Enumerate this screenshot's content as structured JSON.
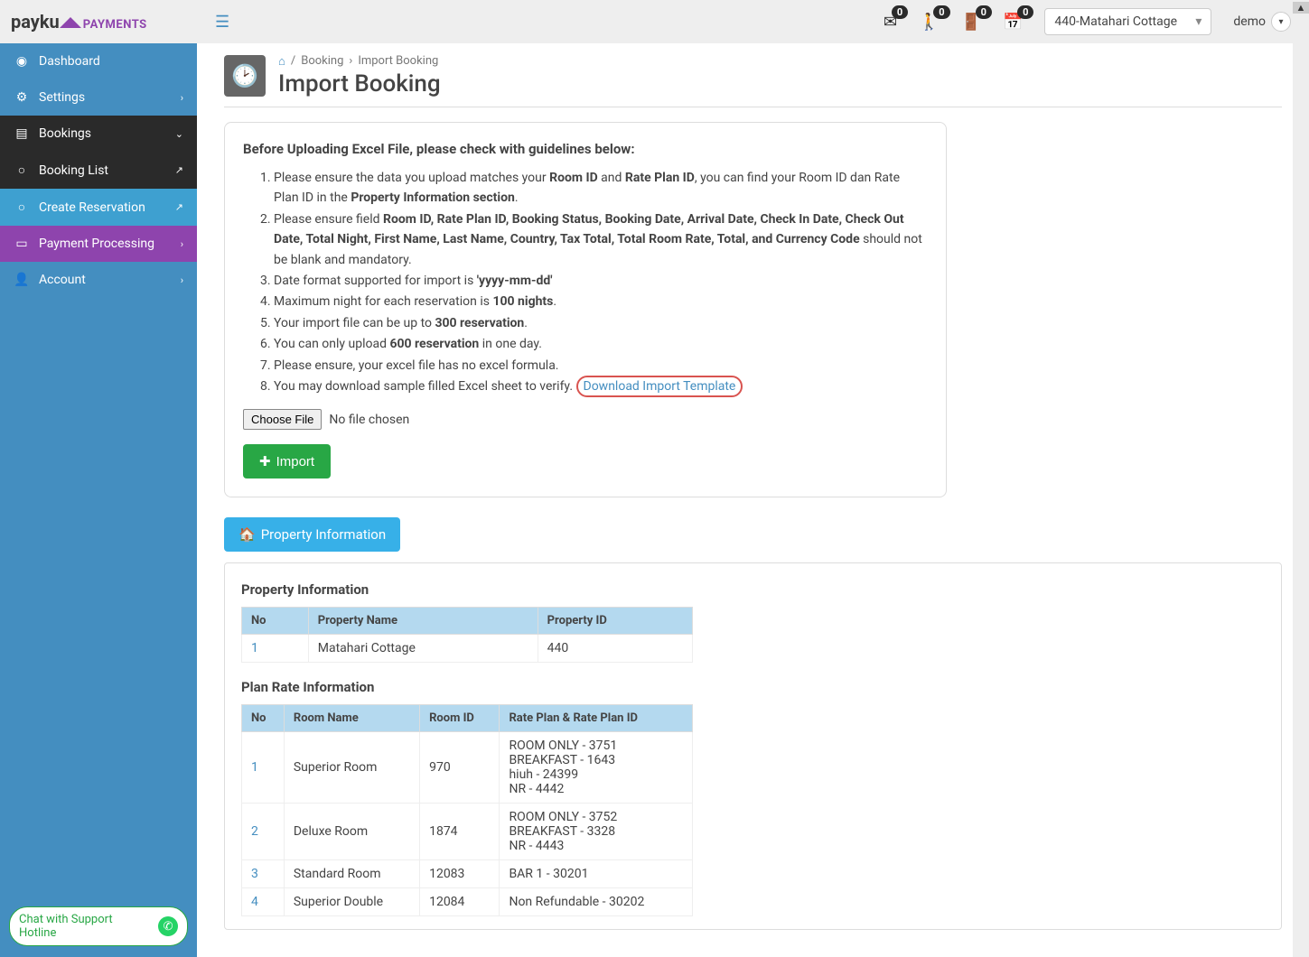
{
  "logo": {
    "main": "payku",
    "accent": "PAYMENTS"
  },
  "topbar": {
    "badges": [
      "0",
      "0",
      "0",
      "0"
    ],
    "property_select": "440-Matahari Cottage",
    "user": "demo"
  },
  "nav": {
    "dashboard": "Dashboard",
    "settings": "Settings",
    "bookings": "Bookings",
    "booking_list": "Booking List",
    "create_reservation": "Create Reservation",
    "payment_processing": "Payment Processing",
    "account": "Account"
  },
  "support": "Chat with Support Hotline",
  "crumbs": {
    "a": "Booking",
    "b": "Import Booking"
  },
  "page_title": "Import Booking",
  "guide": {
    "heading": "Before Uploading Excel File, please check with guidelines below:",
    "items": [
      {
        "pre": "Please ensure the data you upload matches your ",
        "b1": "Room ID",
        "mid": " and ",
        "b2": "Rate Plan ID",
        "post": ", you can find your Room ID dan Rate Plan ID in the ",
        "b3": "Property Information section",
        "tail": "."
      },
      {
        "pre": "Please ensure field ",
        "b1": "Room ID, Rate Plan ID, Booking Status, Booking Date, Arrival Date, Check In Date, Check Out Date, Total Night, First Name, Last Name, Country, Tax Total, Total Room Rate, Total, and Currency Code",
        "post": " should not be blank and mandatory."
      },
      {
        "pre": "Date format supported for import is ",
        "b1": "'yyyy-mm-dd'"
      },
      {
        "pre": "Maximum night for each reservation is ",
        "b1": "100 nights",
        "post": "."
      },
      {
        "pre": "Your import file can be up to ",
        "b1": "300 reservation",
        "post": "."
      },
      {
        "pre": "You can only upload ",
        "b1": "600 reservation",
        "post": " in one day."
      },
      {
        "pre": "Please ensure, your excel file has no excel formula."
      },
      {
        "pre": "You may download sample filled Excel sheet to verify. ",
        "link": "Download Import Template"
      }
    ]
  },
  "file": {
    "choose": "Choose File",
    "status": "No file chosen"
  },
  "import_btn": "Import",
  "prop_info_btn": "Property Information",
  "prop_info": {
    "title": "Property Information",
    "headers": [
      "No",
      "Property Name",
      "Property ID"
    ],
    "rows": [
      [
        "1",
        "Matahari Cottage",
        "440"
      ]
    ]
  },
  "rate_info": {
    "title": "Plan Rate Information",
    "headers": [
      "No",
      "Room Name",
      "Room ID",
      "Rate Plan & Rate Plan ID"
    ],
    "rows": [
      [
        "1",
        "Superior Room",
        "970",
        "ROOM ONLY - 3751\nBREAKFAST - 1643\nhiuh - 24399\nNR - 4442"
      ],
      [
        "2",
        "Deluxe Room",
        "1874",
        "ROOM ONLY - 3752\nBREAKFAST - 3328\nNR - 4443"
      ],
      [
        "3",
        "Standard Room",
        "12083",
        "BAR 1 - 30201"
      ],
      [
        "4",
        "Superior Double",
        "12084",
        "Non Refundable - 30202"
      ]
    ]
  }
}
